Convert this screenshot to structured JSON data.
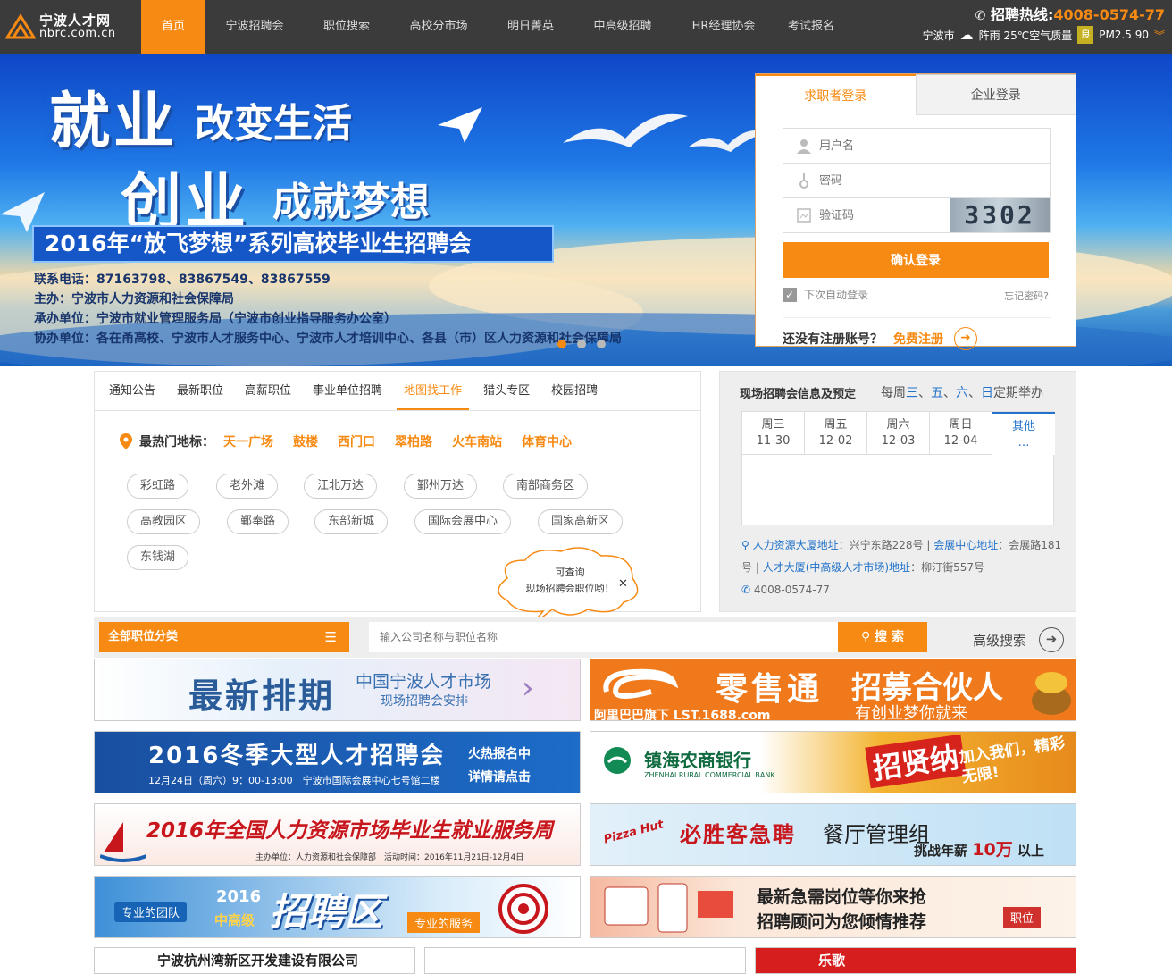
{
  "header": {
    "logo_cn": "宁波人才网",
    "logo_en": "nbrc.com.cn",
    "nav": [
      "首页",
      "宁波招聘会",
      "职位搜索",
      "高校分市场",
      "明日菁英",
      "中高级招聘",
      "HR经理协会",
      "考试报名"
    ],
    "hotline_label": "招聘热线:",
    "hotline_number": "4008-0574-77",
    "city": "宁波市",
    "weather": "阵雨 25℃空气质量",
    "aq_badge": "良",
    "pm25": "PM2.5 90"
  },
  "banner": {
    "line1a": "就业",
    "line1b": "改变生活",
    "line2a": "创业",
    "line2b": "成就梦想",
    "strip": "2016年“放飞梦想”系列高校毕业生招聘会",
    "info": [
      "联系电话：87163798、83867549、83867559",
      "主办：宁波市人力资源和社会保障局",
      "承办单位：宁波市就业管理服务局（宁波市创业指导服务办公室）",
      "协办单位：各在甬高校、宁波市人才服务中心、宁波市人才培训中心、各县（市）区人力资源和社会保障局"
    ]
  },
  "login": {
    "tab_seeker": "求职者登录",
    "tab_company": "企业登录",
    "username_placeholder": "用户名",
    "password_placeholder": "密码",
    "captcha_placeholder": "验证码",
    "captcha": "3302",
    "submit": "确认登录",
    "remember": "下次自动登录",
    "forgot": "忘记密码?",
    "no_account": "还没有注册账号？",
    "register": "免费注册"
  },
  "jobs_panel": {
    "tabs": [
      "通知公告",
      "最新职位",
      "高薪职位",
      "事业单位招聘",
      "地图找工作",
      "猎头专区",
      "校园招聘"
    ],
    "hot_label": "最热门地标：",
    "hot": [
      "天一广场",
      "鼓楼",
      "西门口",
      "翠柏路",
      "火车南站",
      "体育中心"
    ],
    "tags": [
      "彩虹路",
      "老外滩",
      "江北万达",
      "鄞州万达",
      "南部商务区",
      "高教园区",
      "鄞奉路",
      "东部新城",
      "国际会展中心",
      "国家高新区",
      "东钱湖"
    ],
    "bubble_line1": "可查询",
    "bubble_line2": "现场招聘会职位哟！"
  },
  "fair_panel": {
    "title": "现场招聘会信息及预定",
    "schedule_pre": "每周",
    "d1": "三",
    "sep1": "、",
    "d2": "五",
    "sep2": "、",
    "d3": "六",
    "sep3": "、",
    "d4": "日",
    "schedule_post": "定期举办",
    "days": [
      {
        "d": "周三",
        "date": "11-30"
      },
      {
        "d": "周五",
        "date": "12-02"
      },
      {
        "d": "周六",
        "date": "12-03"
      },
      {
        "d": "周日",
        "date": "12-04"
      },
      {
        "d": "其他",
        "date": "…"
      }
    ],
    "addr1_label": "人力资源大厦地址",
    "addr1": "：兴宁东路228号",
    "addr2_label": "会展中心地址",
    "addr2": "：会展路181号",
    "addr3_label": "人才大厦(中高级人才市场)地址",
    "addr3": "：柳汀街557号",
    "phone": "4008-0574-77"
  },
  "search": {
    "category": "全部职位分类",
    "placeholder": "输入公司名称与职位名称",
    "button": "搜 索",
    "advanced": "高级搜索"
  },
  "ads": {
    "a1_big": "最新排期",
    "a1_t1": "中国宁波人才市场",
    "a1_t2": "现场招聘会安排",
    "a2_big": "零售通",
    "a2_t1": "招募合伙人",
    "a2_t2": "有创业梦你就来",
    "a2_brand": "阿里巴巴旗下 LST.1688.com",
    "a3_big": "2016冬季大型人才招聘会",
    "a3_sub": "12月24日（周六）9：00-13:00　宁波市国际会展中心七号馆二楼",
    "a3_r1": "火热报名中",
    "a3_r2": "详情请点击",
    "a4_bank": "镇海农商银行",
    "a4_en": "ZHENHAI RURAL COMMERCIAL BANK",
    "a4_big": "招贤纳",
    "a4_r": "加入我们，精彩无限!",
    "a5_big": "2016年全国人力资源市场毕业生就业服务周",
    "a5_sub": "主办单位：人力资源和社会保障部　活动时间：2016年11月21日-12月4日",
    "a6_big": "必胜客急聘",
    "a6_t": "餐厅管理组",
    "a6_s": "挑战年薪",
    "a6_n": "10万",
    "a6_e": "以上",
    "a6_logo": "Pizza Hut",
    "a7_l": "专业的团队",
    "a7_year": "2016",
    "a7_mid": "中高级",
    "a7_big": "招聘区",
    "a7_r": "专业的服务",
    "a8_l1": "最新急需岗位等你来抢",
    "a8_l2": "招聘顾问为您倾情推荐",
    "a8_r": "职位"
  },
  "bottom": {
    "b1": "宁波杭州湾新区开发建设有限公司",
    "b3": "乐歌"
  }
}
